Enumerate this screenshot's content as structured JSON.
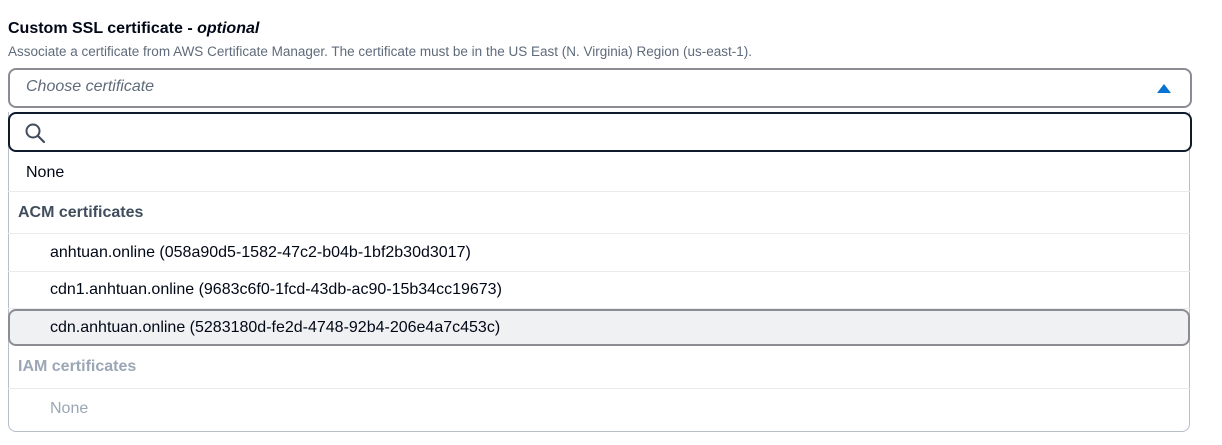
{
  "field": {
    "label": "Custom SSL certificate - ",
    "label_optional": "optional",
    "description": "Associate a certificate from AWS Certificate Manager. The certificate must be in the US East (N. Virginia) Region (us-east-1).",
    "placeholder": "Choose certificate"
  },
  "search": {
    "value": "",
    "icon": "search-icon"
  },
  "options": {
    "none_label": "None",
    "acm_group_label": "ACM certificates",
    "acm_items": [
      {
        "label": "anhtuan.online (058a90d5-1582-47c2-b04b-1bf2b30d3017)"
      },
      {
        "label": "cdn1.anhtuan.online (9683c6f0-1fcd-43db-ac90-15b34cc19673)"
      },
      {
        "label": "cdn.anhtuan.online (5283180d-fe2d-4748-92b4-206e4a7c453c)"
      }
    ],
    "iam_group_label": "IAM certificates",
    "iam_none_label": "None"
  },
  "colors": {
    "accent": "#0972d3",
    "focus_border": "#0f1b2a",
    "disabled_text": "#9ba7b6",
    "highlight_bg": "#f0f1f3"
  }
}
